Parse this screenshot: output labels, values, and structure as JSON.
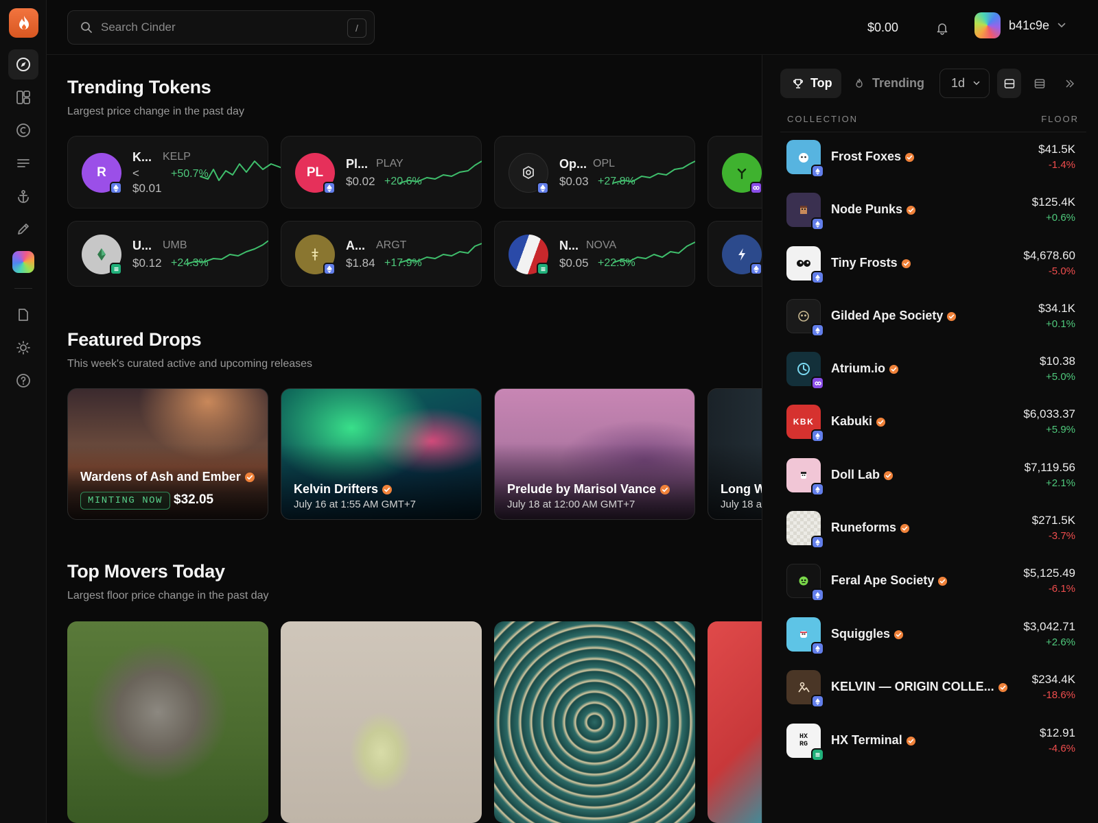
{
  "search": {
    "placeholder": "Search Cinder",
    "shortcut": "/"
  },
  "header": {
    "balance": "$0.00",
    "username": "b41c9e"
  },
  "trending": {
    "title": "Trending Tokens",
    "subtitle": "Largest price change in the past day",
    "tokens": [
      {
        "name": "K...",
        "symbol": "KELP",
        "price_prefix": "<",
        "price": "$0.01",
        "change": "+50.7%",
        "avatar_text": "R",
        "avatar_color": "#9b4fe8",
        "chain": "eth"
      },
      {
        "name": "Pl...",
        "symbol": "PLAY",
        "price": "$0.02",
        "change": "+20.6%",
        "avatar_text": "PL",
        "avatar_color": "#e6305a",
        "chain": "eth"
      },
      {
        "name": "Op...",
        "symbol": "OPL",
        "price": "$0.03",
        "change": "+27.8%",
        "avatar_color": "#1b1b1b",
        "chain": "eth"
      },
      {
        "avatar_color": "#3fb22f",
        "chain": "sol"
      },
      {
        "name": "U...",
        "symbol": "UMB",
        "price": "$0.12",
        "change": "+24.3%",
        "avatar_color": "#c7c7c7",
        "chain": "base"
      },
      {
        "name": "A...",
        "symbol": "ARGT",
        "price": "$1.84",
        "change": "+17.9%",
        "avatar_color": "#8a7630",
        "chain": "eth"
      },
      {
        "name": "N...",
        "symbol": "NOVA",
        "price": "$0.05",
        "change": "+22.5%",
        "avatar_color": "#e8e8e8",
        "chain": "base"
      },
      {
        "avatar_color": "#2c4a8c",
        "chain": "eth"
      }
    ]
  },
  "featured": {
    "title": "Featured Drops",
    "subtitle": "This week's curated active and upcoming releases",
    "drops": [
      {
        "title": "Wardens of Ash and Ember",
        "badge": "MINTING NOW",
        "price": "$32.05"
      },
      {
        "title": "Kelvin Drifters",
        "date": "July 16 at 1:55 AM GMT+7"
      },
      {
        "title": "Prelude by Marisol Vance",
        "date": "July 18 at 12:00 AM GMT+7"
      },
      {
        "title": "Long W",
        "date": "July 18 a"
      }
    ]
  },
  "movers": {
    "title": "Top Movers Today",
    "subtitle": "Largest floor price change in the past day"
  },
  "panel": {
    "tab_top": "Top",
    "tab_trending": "Trending",
    "period": "1d",
    "col_collection": "COLLECTION",
    "col_floor": "FLOOR",
    "collections": [
      {
        "name": "Frost Foxes",
        "floor": "$41.5K",
        "change": "-1.4%",
        "dir": "down",
        "chain": "eth",
        "bg": "#57b4e0"
      },
      {
        "name": "Node Punks",
        "floor": "$125.4K",
        "change": "+0.6%",
        "dir": "up",
        "chain": "eth",
        "bg": "#3a3050"
      },
      {
        "name": "Tiny Frosts",
        "floor": "$4,678.60",
        "change": "-5.0%",
        "dir": "down",
        "chain": "eth",
        "bg": "#f2f2f2"
      },
      {
        "name": "Gilded Ape Society",
        "floor": "$34.1K",
        "change": "+0.1%",
        "dir": "up",
        "chain": "eth",
        "bg": "#1a1a1a"
      },
      {
        "name": "Atrium.io",
        "floor": "$10.38",
        "change": "+5.0%",
        "dir": "up",
        "chain": "sol",
        "bg": "#13303a"
      },
      {
        "name": "Kabuki",
        "floor": "$6,033.37",
        "change": "+5.9%",
        "dir": "up",
        "chain": "eth",
        "bg": "#d6322f",
        "logo_text": "KBK"
      },
      {
        "name": "Doll Lab",
        "floor": "$7,119.56",
        "change": "+2.1%",
        "dir": "up",
        "chain": "eth",
        "bg": "#f1c6d6"
      },
      {
        "name": "Runeforms",
        "floor": "$271.5K",
        "change": "-3.7%",
        "dir": "down",
        "chain": "eth",
        "bg": "#e8e6df"
      },
      {
        "name": "Feral Ape Society",
        "floor": "$5,125.49",
        "change": "-6.1%",
        "dir": "down",
        "chain": "eth",
        "bg": "#121212"
      },
      {
        "name": "Squiggles",
        "floor": "$3,042.71",
        "change": "+2.6%",
        "dir": "up",
        "chain": "eth",
        "bg": "#5ec4e6"
      },
      {
        "name": "KELVIN — ORIGIN COLLE...",
        "floor": "$234.4K",
        "change": "-18.6%",
        "dir": "down",
        "chain": "eth",
        "bg": "#4a3626"
      },
      {
        "name": "HX Terminal",
        "floor": "$12.91",
        "change": "-4.6%",
        "dir": "down",
        "chain": "base",
        "bg": "#f4f4f4",
        "logo_text": "HX RG"
      }
    ]
  },
  "colors": {
    "accent": "#f06a2f",
    "positive": "#4fc97c",
    "negative": "#ef4d4d",
    "verified": "#f0823a"
  },
  "icons": {
    "sidebar": [
      "flame-logo-icon",
      "compass-icon",
      "dashboard-icon",
      "copyright-icon",
      "list-icon",
      "anchor-icon",
      "pencil-icon",
      "gradient-app-icon",
      "document-icon",
      "sun-icon",
      "help-icon"
    ]
  }
}
